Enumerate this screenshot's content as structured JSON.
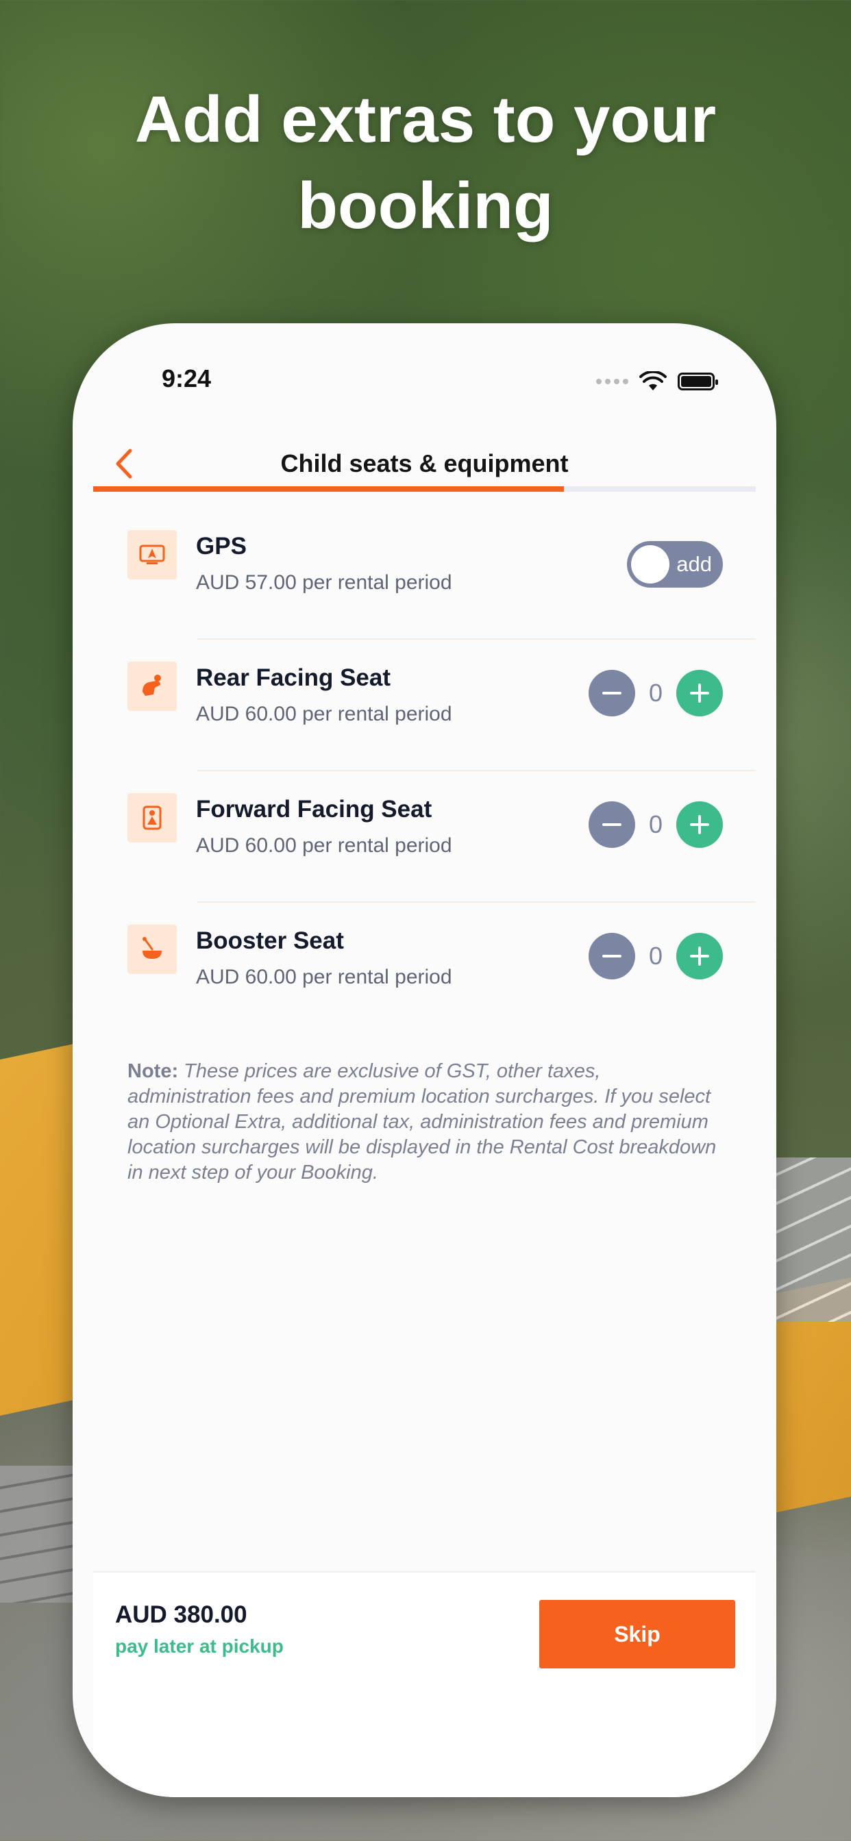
{
  "headline": "Add extras to your booking",
  "status_bar": {
    "time": "9:24"
  },
  "nav": {
    "title": "Child seats & equipment",
    "progress": 0.71
  },
  "items": [
    {
      "title": "GPS",
      "price": "AUD 57.00 per rental period",
      "control": "toggle",
      "toggle_label": "add",
      "icon": "gps-device-icon"
    },
    {
      "title": "Rear Facing Seat",
      "price": "AUD 60.00 per rental period",
      "control": "stepper",
      "count": "0",
      "icon": "rear-facing-seat-icon"
    },
    {
      "title": "Forward Facing Seat",
      "price": "AUD 60.00 per rental period",
      "control": "stepper",
      "count": "0",
      "icon": "forward-facing-seat-icon"
    },
    {
      "title": "Booster Seat",
      "price": "AUD 60.00 per rental period",
      "control": "stepper",
      "count": "0",
      "icon": "booster-seat-icon"
    }
  ],
  "note": {
    "label": "Note:",
    "text": " These prices are exclusive of GST, other taxes, administration fees and premium location surcharges. If you select an Optional Extra, additional tax, administration fees and premium location surcharges will be displayed in the Rental Cost breakdown in next step of your Booking."
  },
  "footer": {
    "total": "AUD 380.00",
    "subtext": "pay later at pickup",
    "skip_label": "Skip"
  },
  "colors": {
    "accent": "#f5621e",
    "plus": "#3dbb8b",
    "minus": "#7c86a3"
  }
}
